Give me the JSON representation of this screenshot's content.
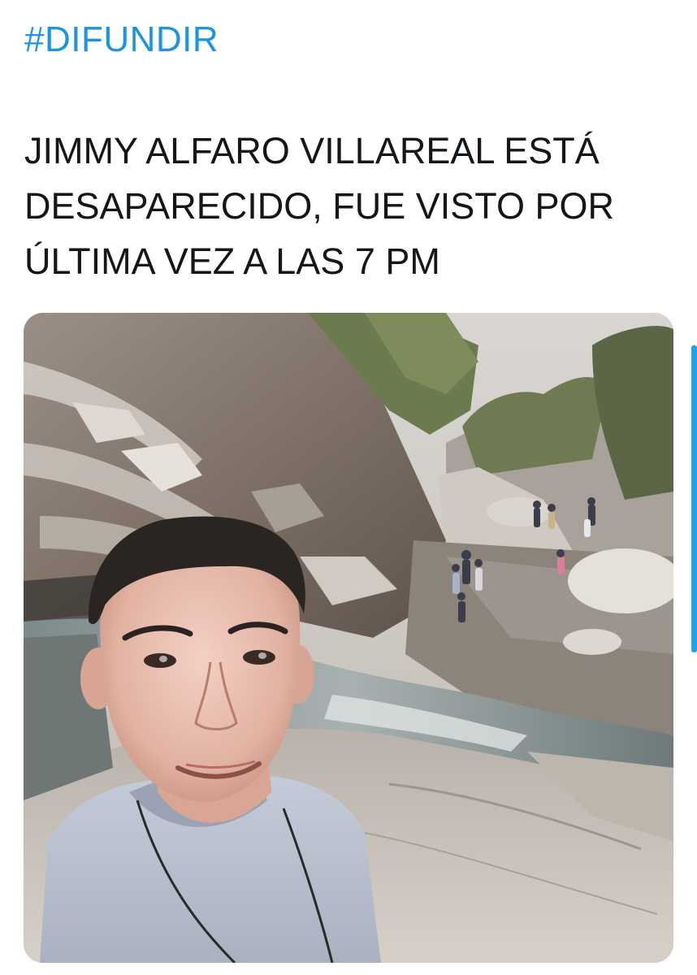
{
  "tweet": {
    "hashtag": "#DIFUNDIR",
    "text_lines": [
      "JIMMY ALFARO VILLAREAL ESTÁ",
      "DESAPARECIDO, FUE VISTO POR",
      "ÚLTIMA VEZ A LAS 7 PM"
    ]
  },
  "media": {
    "type": "photo"
  },
  "colors": {
    "hashtag_link": "#1b95e0",
    "text": "#14171a",
    "scroll_indicator": "#1da1f2"
  }
}
